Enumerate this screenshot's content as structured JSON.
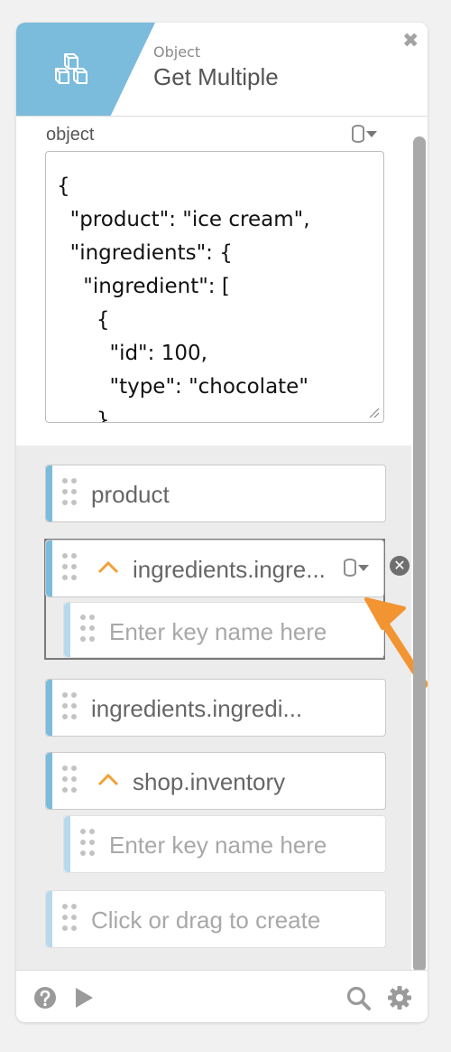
{
  "header": {
    "subtitle": "Object",
    "title": "Get Multiple",
    "close_label": "✖",
    "icon": "cubes-icon"
  },
  "object_field": {
    "label": "object",
    "value": "{\n  \"product\": \"ice cream\",\n  \"ingredients\": {\n    \"ingredient\": [\n      {\n        \"id\": 100,\n        \"type\": \"chocolate\"\n      },"
  },
  "keys": [
    {
      "label": "product",
      "expandable": false
    },
    {
      "label": "ingredients.ingre...",
      "expandable": true,
      "child_placeholder": "Enter key name here"
    },
    {
      "label": "ingredients.ingredi...",
      "expandable": false
    },
    {
      "label": "shop.inventory",
      "expandable": true,
      "child_placeholder": "Enter key name here"
    }
  ],
  "create_placeholder": "Click or drag to create",
  "remove_label": "✕",
  "footer": {
    "icons": [
      "help-icon",
      "play-icon",
      "search-icon",
      "gear-icon"
    ]
  },
  "colors": {
    "accent": "#7bbbdc",
    "chevron": "#f0a23a",
    "arrow": "#f29431"
  }
}
